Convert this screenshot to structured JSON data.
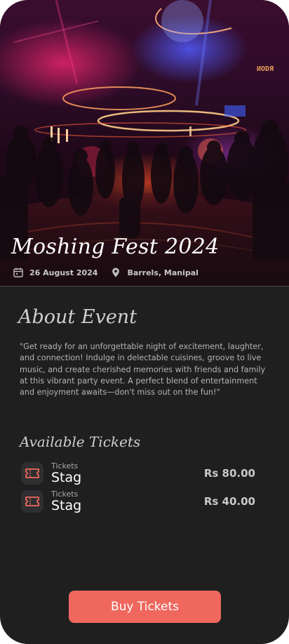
{
  "event": {
    "title": "Moshing Fest 2024",
    "date": "26 August 2024",
    "location": "Barrels, Manipal",
    "date_icon": "calendar-icon",
    "location_icon": "map-pin-icon"
  },
  "about": {
    "heading": "About Event",
    "description": "\"Get ready for an unforgettable night of excitement, laughter, and connection! Indulge in delectable cuisines, groove to live music, and create cherished memories with friends and family at this vibrant party event. A perfect blend of entertainment and enjoyment awaits—don't miss out on the fun!\""
  },
  "tickets": {
    "heading": "Available Tickets",
    "items": [
      {
        "kind": "Tickets",
        "name": "Stag",
        "price": "Rs 80.00",
        "icon": "ticket-icon"
      },
      {
        "kind": "Tickets",
        "name": "Stag",
        "price": "Rs 40.00",
        "icon": "ticket-icon"
      }
    ]
  },
  "actions": {
    "buy_label": "Buy Tickets"
  },
  "colors": {
    "background": "#1f1f20",
    "accent": "#f0675e",
    "icon_bg": "#2f2f31"
  }
}
